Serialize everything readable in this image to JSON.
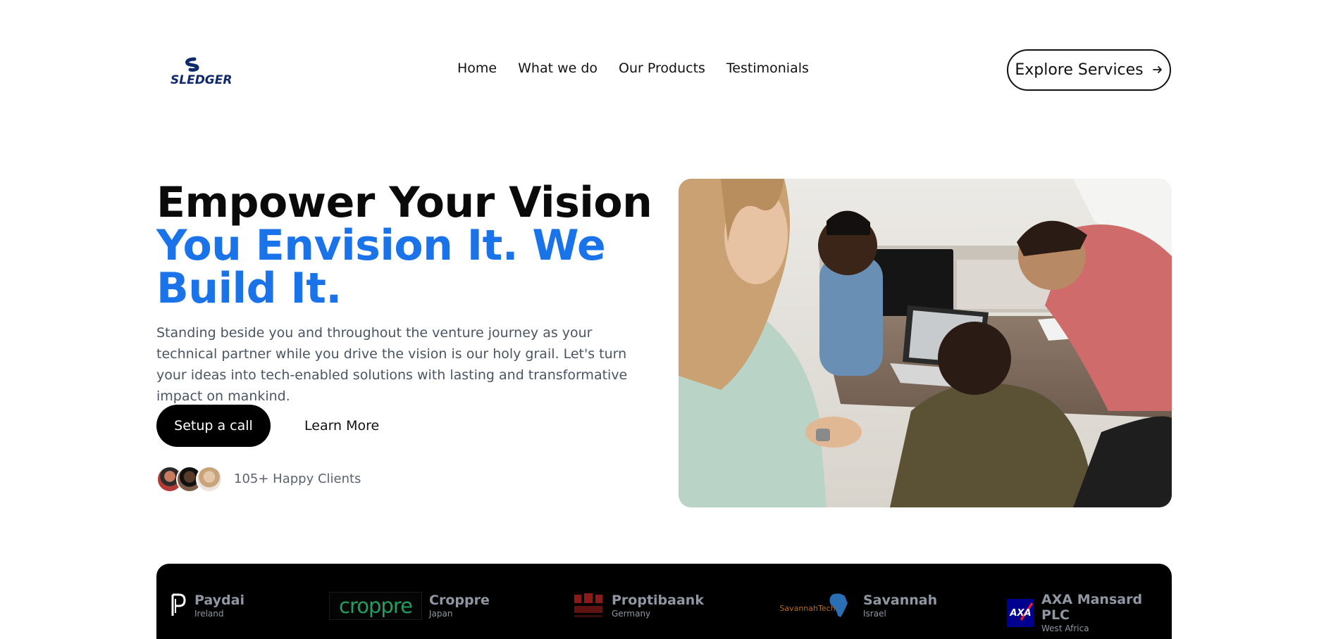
{
  "brand": {
    "name": "SLEDGER"
  },
  "nav": {
    "items": [
      {
        "label": "Home"
      },
      {
        "label": "What we do"
      },
      {
        "label": "Our Products"
      },
      {
        "label": "Testimonials"
      }
    ],
    "cta_label": "Explore Services",
    "cta_icon": "arrow-right-icon"
  },
  "hero": {
    "title_line1": "Empower Your Vision",
    "title_line2": "You Envision It. We Build It.",
    "description": "Standing beside you and throughout the venture journey as your technical partner while you drive the vision is our holy grail. Let's turn your ideas into tech-enabled solutions with lasting and transformative impact on mankind.",
    "primary_button": "Setup a call",
    "secondary_button": "Learn More",
    "clients_text": "105+ Happy Clients",
    "image_icon": "team-meeting-photo"
  },
  "partners": [
    {
      "name": "Paydai",
      "country": "Ireland",
      "logo_text": ""
    },
    {
      "name": "Croppre",
      "country": "Japan",
      "logo_text": "croppre"
    },
    {
      "name": "Proptibaank",
      "country": "Germany",
      "logo_text": ""
    },
    {
      "name": "Savannah",
      "country": "Israel",
      "logo_text": "SavannahTech"
    },
    {
      "name": "AXA Mansard PLC",
      "country": "West Africa",
      "logo_text": "AXA"
    }
  ],
  "colors": {
    "accent_blue": "#1a73e8",
    "text_dark": "#0a0a0a",
    "muted_text": "#4a5563",
    "partner_bar": "#000000",
    "croppre_green": "#1f9d63",
    "axa_blue": "#00008f",
    "axa_red": "#ff1721"
  }
}
